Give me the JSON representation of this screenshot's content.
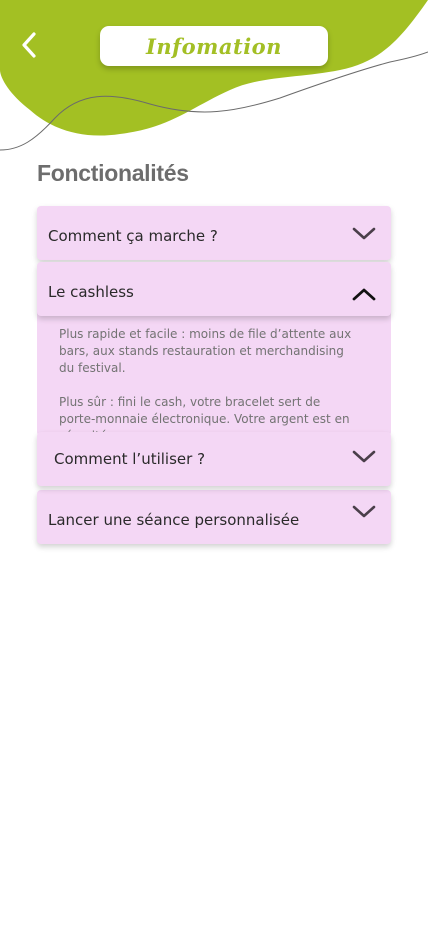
{
  "header": {
    "title": "Infomation",
    "back_icon": "chevron-left-icon",
    "accent_color": "#a3c023"
  },
  "section": {
    "title": "Fonctionalités"
  },
  "accordion": {
    "background_color": "#f4d7f5",
    "items": [
      {
        "label": "Comment ça marche ?",
        "expanded": false,
        "icon": "chevron-down-icon"
      },
      {
        "label": "Le cashless",
        "expanded": true,
        "icon": "chevron-up-icon",
        "paragraphs": [
          "Plus rapide et facile : moins de file d’attente aux bars, aux stands restauration et merchandising du festival.",
          "Plus sûr : fini le cash, votre bracelet sert de porte-monnaie électronique. Votre argent est en sécurité"
        ]
      },
      {
        "label": "Comment l’utiliser ?",
        "expanded": false,
        "icon": "chevron-down-icon"
      },
      {
        "label": "Lancer une séance personnalisée",
        "expanded": false,
        "icon": "chevron-down-icon"
      }
    ]
  }
}
